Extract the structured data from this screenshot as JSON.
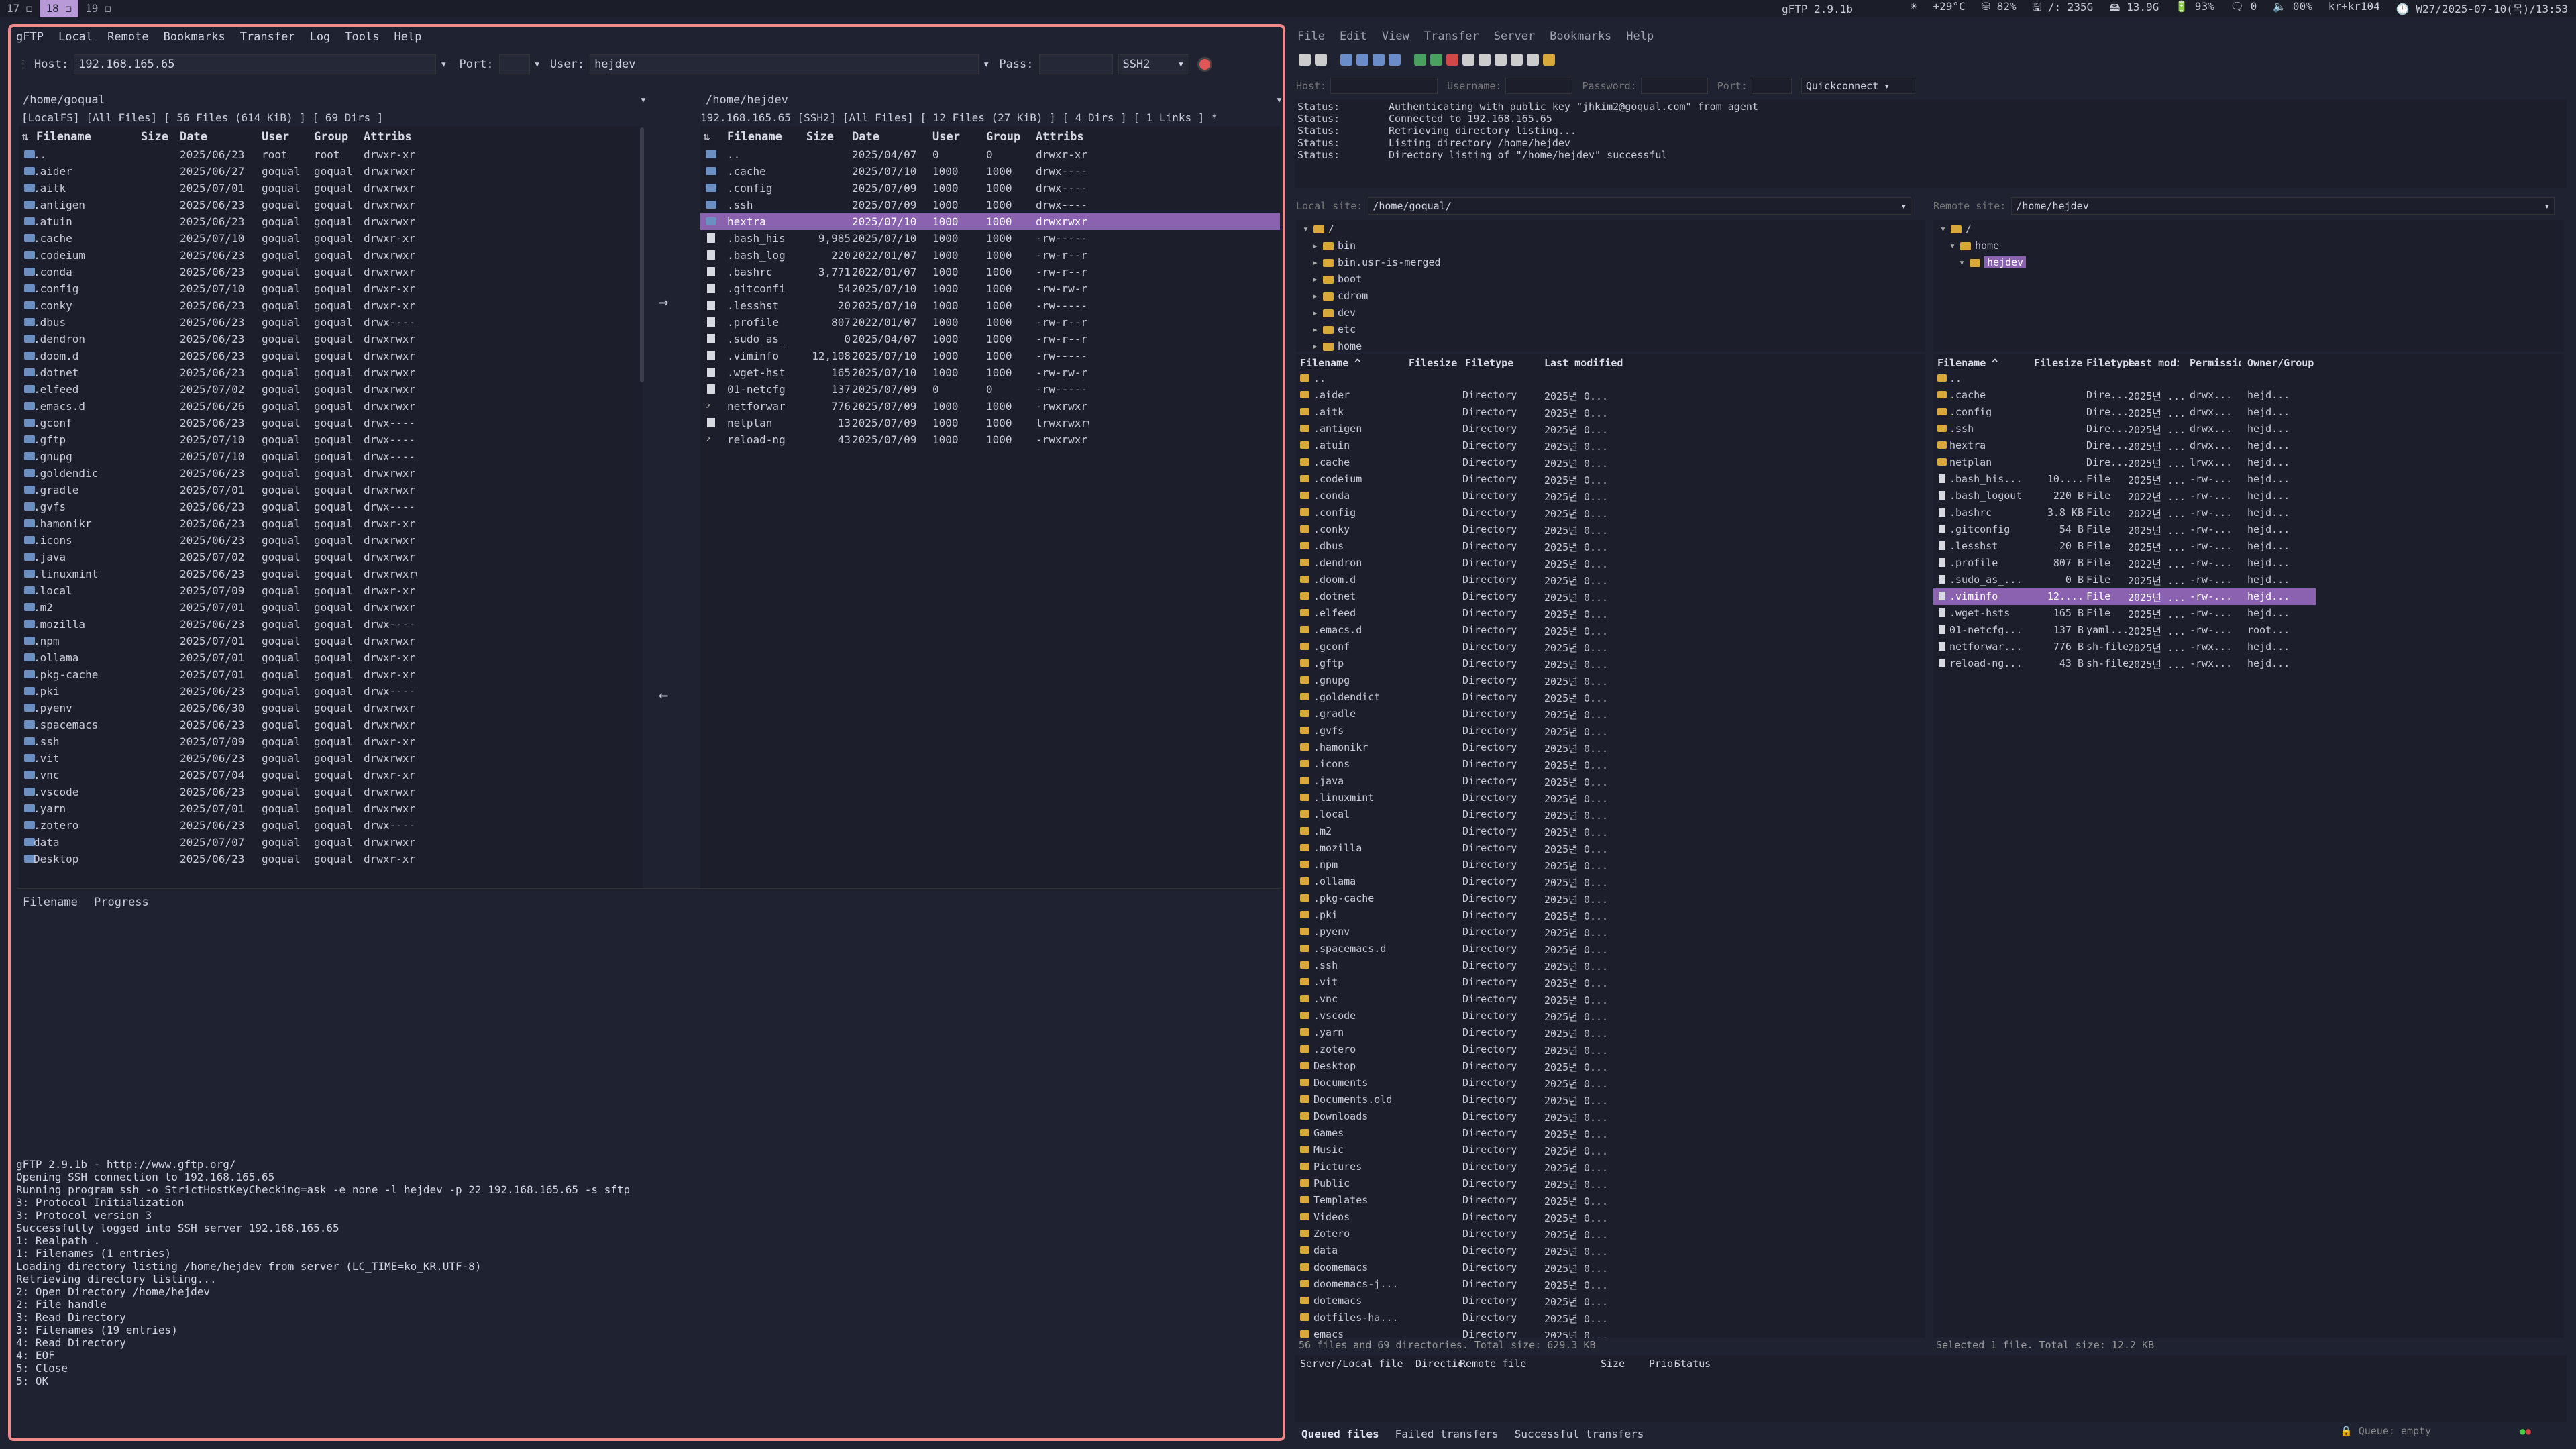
{
  "topbar": {
    "workspaces": [
      {
        "label": "17 ◻",
        "active": false
      },
      {
        "label": "18 ◻",
        "active": true
      },
      {
        "label": "19 ◻",
        "active": false
      }
    ],
    "title": "gFTP 2.9.1b",
    "status": [
      "☀",
      "+29°C",
      "⛁ 82%",
      "🖫 /: 235G",
      "🖴 13.9G",
      "🔋 93%",
      "🗨 0",
      "🔈 00%",
      "kr+kr104",
      "🕒 W27/2025-07-10(목)/13:53"
    ]
  },
  "left": {
    "menu": [
      "gFTP",
      "Local",
      "Remote",
      "Bookmarks",
      "Transfer",
      "Log",
      "Tools",
      "Help"
    ],
    "host_label": "Host:",
    "host": "192.168.165.65",
    "port_label": "Port:",
    "port": "",
    "user_label": "User:",
    "user": "hejdev",
    "pass_label": "Pass:",
    "pass": "",
    "protocol": "SSH2",
    "local_path": "/home/goqual",
    "remote_path": "/home/hejdev",
    "local_status": "[LocalFS] [All Files] [ 56 Files (614 KiB) ] [ 69 Dirs ]",
    "remote_status": "192.168.165.65 [SSH2] [All Files] [ 12 Files (27 KiB) ] [ 4 Dirs ] [ 1 Links ] *",
    "cols": [
      "Filename",
      "Size",
      "Date",
      "User",
      "Group",
      "Attribs"
    ],
    "local_files": [
      [
        "..",
        "",
        "2025/06/23",
        "root",
        "root",
        "drwxr-xr-x"
      ],
      [
        ".aider",
        "",
        "2025/06/27",
        "goqual",
        "goqual",
        "drwxrwxr-x"
      ],
      [
        ".aitk",
        "",
        "2025/07/01",
        "goqual",
        "goqual",
        "drwxrwxr-x"
      ],
      [
        ".antigen",
        "",
        "2025/06/23",
        "goqual",
        "goqual",
        "drwxrwxr-x"
      ],
      [
        ".atuin",
        "",
        "2025/06/23",
        "goqual",
        "goqual",
        "drwxrwxr-x"
      ],
      [
        ".cache",
        "",
        "2025/07/10",
        "goqual",
        "goqual",
        "drwxr-xr-x"
      ],
      [
        ".codeium",
        "",
        "2025/06/23",
        "goqual",
        "goqual",
        "drwxrwxr-x"
      ],
      [
        ".conda",
        "",
        "2025/06/23",
        "goqual",
        "goqual",
        "drwxrwxr-x"
      ],
      [
        ".config",
        "",
        "2025/07/10",
        "goqual",
        "goqual",
        "drwxr-xr-x"
      ],
      [
        ".conky",
        "",
        "2025/06/23",
        "goqual",
        "goqual",
        "drwxr-xr-x"
      ],
      [
        ".dbus",
        "",
        "2025/06/23",
        "goqual",
        "goqual",
        "drwx------"
      ],
      [
        ".dendron",
        "",
        "2025/06/23",
        "goqual",
        "goqual",
        "drwxrwxr-x"
      ],
      [
        ".doom.d",
        "",
        "2025/06/23",
        "goqual",
        "goqual",
        "drwxrwxr-x"
      ],
      [
        ".dotnet",
        "",
        "2025/06/23",
        "goqual",
        "goqual",
        "drwxrwxr-x"
      ],
      [
        ".elfeed",
        "",
        "2025/07/02",
        "goqual",
        "goqual",
        "drwxrwxr-x"
      ],
      [
        ".emacs.d",
        "",
        "2025/06/26",
        "goqual",
        "goqual",
        "drwxrwxr-x"
      ],
      [
        ".gconf",
        "",
        "2025/06/23",
        "goqual",
        "goqual",
        "drwx------"
      ],
      [
        ".gftp",
        "",
        "2025/07/10",
        "goqual",
        "goqual",
        "drwx------"
      ],
      [
        ".gnupg",
        "",
        "2025/07/10",
        "goqual",
        "goqual",
        "drwx------"
      ],
      [
        ".goldendict",
        "",
        "2025/06/23",
        "goqual",
        "goqual",
        "drwxrwxr-x"
      ],
      [
        ".gradle",
        "",
        "2025/07/01",
        "goqual",
        "goqual",
        "drwxrwxr-x"
      ],
      [
        ".gvfs",
        "",
        "2025/06/23",
        "goqual",
        "goqual",
        "drwx------"
      ],
      [
        ".hamonikr",
        "",
        "2025/06/23",
        "goqual",
        "goqual",
        "drwxr-xr-x"
      ],
      [
        ".icons",
        "",
        "2025/06/23",
        "goqual",
        "goqual",
        "drwxrwxr-x"
      ],
      [
        ".java",
        "",
        "2025/07/02",
        "goqual",
        "goqual",
        "drwxrwxr-x"
      ],
      [
        ".linuxmint",
        "",
        "2025/06/23",
        "goqual",
        "goqual",
        "drwxrwxrwx"
      ],
      [
        ".local",
        "",
        "2025/07/09",
        "goqual",
        "goqual",
        "drwxr-xr-x"
      ],
      [
        ".m2",
        "",
        "2025/07/01",
        "goqual",
        "goqual",
        "drwxrwxr-x"
      ],
      [
        ".mozilla",
        "",
        "2025/06/23",
        "goqual",
        "goqual",
        "drwx------"
      ],
      [
        ".npm",
        "",
        "2025/07/01",
        "goqual",
        "goqual",
        "drwxrwxr-x"
      ],
      [
        ".ollama",
        "",
        "2025/07/01",
        "goqual",
        "goqual",
        "drwxr-xr-x"
      ],
      [
        ".pkg-cache",
        "",
        "2025/07/01",
        "goqual",
        "goqual",
        "drwxr-xr-x"
      ],
      [
        ".pki",
        "",
        "2025/06/23",
        "goqual",
        "goqual",
        "drwx------"
      ],
      [
        ".pyenv",
        "",
        "2025/06/30",
        "goqual",
        "goqual",
        "drwxrwxr-x"
      ],
      [
        ".spacemacs",
        "",
        "2025/06/23",
        "goqual",
        "goqual",
        "drwxrwxr-x"
      ],
      [
        ".ssh",
        "",
        "2025/07/09",
        "goqual",
        "goqual",
        "drwxr-xr-x"
      ],
      [
        ".vit",
        "",
        "2025/06/23",
        "goqual",
        "goqual",
        "drwxrwxr-x"
      ],
      [
        ".vnc",
        "",
        "2025/07/04",
        "goqual",
        "goqual",
        "drwxr-xr-x"
      ],
      [
        ".vscode",
        "",
        "2025/06/23",
        "goqual",
        "goqual",
        "drwxrwxr-x"
      ],
      [
        ".yarn",
        "",
        "2025/07/01",
        "goqual",
        "goqual",
        "drwxrwxr-x"
      ],
      [
        ".zotero",
        "",
        "2025/06/23",
        "goqual",
        "goqual",
        "drwx------"
      ],
      [
        "data",
        "",
        "2025/07/07",
        "goqual",
        "goqual",
        "drwxrwxr-x"
      ],
      [
        "Desktop",
        "",
        "2025/06/23",
        "goqual",
        "goqual",
        "drwxr-xr-x"
      ]
    ],
    "remote_files": [
      [
        "..",
        "",
        "2025/04/07",
        "0",
        "0",
        "drwxr-xr-x",
        "d"
      ],
      [
        ".cache",
        "",
        "2025/07/10",
        "1000",
        "1000",
        "drwx------",
        "d"
      ],
      [
        ".config",
        "",
        "2025/07/09",
        "1000",
        "1000",
        "drwx------",
        "d"
      ],
      [
        ".ssh",
        "",
        "2025/07/09",
        "1000",
        "1000",
        "drwx------",
        "d"
      ],
      [
        "hextra",
        "",
        "2025/07/10",
        "1000",
        "1000",
        "drwxrwxr-x",
        "d"
      ],
      [
        ".bash_his",
        "9,985",
        "2025/07/10",
        "1000",
        "1000",
        "-rw-------",
        "f"
      ],
      [
        ".bash_log",
        "220",
        "2022/01/07",
        "1000",
        "1000",
        "-rw-r--r--",
        "f"
      ],
      [
        ".bashrc",
        "3,771",
        "2022/01/07",
        "1000",
        "1000",
        "-rw-r--r--",
        "f"
      ],
      [
        ".gitconfi",
        "54",
        "2025/07/10",
        "1000",
        "1000",
        "-rw-rw-r--",
        "f"
      ],
      [
        ".lesshst",
        "20",
        "2025/07/10",
        "1000",
        "1000",
        "-rw-------",
        "f"
      ],
      [
        ".profile",
        "807",
        "2022/01/07",
        "1000",
        "1000",
        "-rw-r--r--",
        "f"
      ],
      [
        ".sudo_as_",
        "0",
        "2025/04/07",
        "1000",
        "1000",
        "-rw-r--r--",
        "f"
      ],
      [
        ".viminfo",
        "12,108",
        "2025/07/10",
        "1000",
        "1000",
        "-rw-------",
        "f"
      ],
      [
        ".wget-hst",
        "165",
        "2025/07/10",
        "1000",
        "1000",
        "-rw-rw-r--",
        "f"
      ],
      [
        "01-netcfg",
        "137",
        "2025/07/09",
        "0",
        "0",
        "-rw-------",
        "f"
      ],
      [
        "netforwar",
        "776",
        "2025/07/09",
        "1000",
        "1000",
        "-rwxrwxr-x",
        "l"
      ],
      [
        "netplan",
        "13",
        "2025/07/09",
        "1000",
        "1000",
        "lrwxrwxrwx",
        "f"
      ],
      [
        "reload-ng",
        "43",
        "2025/07/09",
        "1000",
        "1000",
        "-rwxrwxr-x",
        "l"
      ]
    ],
    "selected_remote": "hextra",
    "transfer_cols": [
      "Filename",
      "Progress"
    ],
    "log": [
      "gFTP 2.9.1b - http://www.gftp.org/",
      "Opening SSH connection to 192.168.165.65",
      "Running program ssh -o StrictHostKeyChecking=ask -e none -l hejdev -p 22 192.168.165.65 -s sftp",
      "3: Protocol Initialization",
      "3: Protocol version 3",
      "Successfully logged into SSH server 192.168.165.65",
      "1: Realpath .",
      "1: Filenames (1 entries)",
      "Loading directory listing /home/hejdev from server (LC_TIME=ko_KR.UTF-8)",
      "Retrieving directory listing...",
      "2: Open Directory /home/hejdev",
      "2: File handle",
      "3: Read Directory",
      "3: Filenames (19 entries)",
      "4: Read Directory",
      "4: EOF",
      "5: Close",
      "5: OK"
    ]
  },
  "right": {
    "menu": [
      "File",
      "Edit",
      "View",
      "Transfer",
      "Server",
      "Bookmarks",
      "Help"
    ],
    "qc": {
      "host": "Host:",
      "username": "Username:",
      "password": "Password:",
      "port": "Port:",
      "button": "Quickconnect"
    },
    "status": [
      [
        "Status:",
        "Authenticating with public key \"jhkim2@goqual.com\" from agent"
      ],
      [
        "Status:",
        "Connected to 192.168.165.65"
      ],
      [
        "Status:",
        "Retrieving directory listing..."
      ],
      [
        "Status:",
        "Listing directory /home/hejdev"
      ],
      [
        "Status:",
        "Directory listing of \"/home/hejdev\" successful"
      ]
    ],
    "local_site_label": "Local site:",
    "local_site": "/home/goqual/",
    "remote_site_label": "Remote site:",
    "remote_site": "/home/hejdev",
    "local_tree": [
      {
        "label": "/",
        "indent": 0,
        "open": true
      },
      {
        "label": "bin",
        "indent": 1,
        "open": false
      },
      {
        "label": "bin.usr-is-merged",
        "indent": 1,
        "open": false
      },
      {
        "label": "boot",
        "indent": 1,
        "open": false
      },
      {
        "label": "cdrom",
        "indent": 1,
        "open": false
      },
      {
        "label": "dev",
        "indent": 1,
        "open": false
      },
      {
        "label": "etc",
        "indent": 1,
        "open": false
      },
      {
        "label": "home",
        "indent": 1,
        "open": false
      }
    ],
    "remote_tree": [
      {
        "label": "/",
        "indent": 0,
        "sel": false
      },
      {
        "label": "home",
        "indent": 1,
        "sel": false
      },
      {
        "label": "hejdev",
        "indent": 2,
        "sel": true
      }
    ],
    "local_cols": [
      "Filename ^",
      "Filesize",
      "Filetype",
      "Last modified"
    ],
    "local_type": "Directory",
    "local_mod": "2025년 0...",
    "local_list": [
      "..",
      ".aider",
      ".aitk",
      ".antigen",
      ".atuin",
      ".cache",
      ".codeium",
      ".conda",
      ".config",
      ".conky",
      ".dbus",
      ".dendron",
      ".doom.d",
      ".dotnet",
      ".elfeed",
      ".emacs.d",
      ".gconf",
      ".gftp",
      ".gnupg",
      ".goldendict",
      ".gradle",
      ".gvfs",
      ".hamonikr",
      ".icons",
      ".java",
      ".linuxmint",
      ".local",
      ".m2",
      ".mozilla",
      ".npm",
      ".ollama",
      ".pkg-cache",
      ".pki",
      ".pyenv",
      ".spacemacs.d",
      ".ssh",
      ".vit",
      ".vnc",
      ".vscode",
      ".yarn",
      ".zotero",
      "Desktop",
      "Documents",
      "Documents.old",
      "Downloads",
      "Games",
      "Music",
      "Pictures",
      "Public",
      "Templates",
      "Videos",
      "Zotero",
      "data",
      "doomemacs",
      "doomemacs-j...",
      "dotemacs",
      "dotfiles-ha...",
      "emacs"
    ],
    "remote_cols": [
      "Filename ^",
      "Filesize",
      "Filetype",
      "Last modified",
      "Permissions",
      "Owner/Group"
    ],
    "remote_list": [
      [
        "..",
        "",
        "",
        "",
        "",
        ""
      ],
      [
        ".cache",
        "",
        "Dire...",
        "2025년 ...",
        "drwx...",
        "hejd..."
      ],
      [
        ".config",
        "",
        "Dire...",
        "2025년 ...",
        "drwx...",
        "hejd..."
      ],
      [
        ".ssh",
        "",
        "Dire...",
        "2025년 ...",
        "drwx...",
        "hejd..."
      ],
      [
        "hextra",
        "",
        "Dire...",
        "2025년 ...",
        "drwx...",
        "hejd..."
      ],
      [
        "netplan",
        "",
        "Dire...",
        "2025년 ...",
        "lrwx...",
        "hejd..."
      ],
      [
        ".bash_his...",
        "10....",
        "File",
        "2025년 ...",
        "-rw-...",
        "hejd..."
      ],
      [
        ".bash_logout",
        "220 B",
        "File",
        "2022년 ...",
        "-rw-...",
        "hejd..."
      ],
      [
        ".bashrc",
        "3.8 KB",
        "File",
        "2022년 ...",
        "-rw-...",
        "hejd..."
      ],
      [
        ".gitconfig",
        "54 B",
        "File",
        "2025년 ...",
        "-rw-...",
        "hejd..."
      ],
      [
        ".lesshst",
        "20 B",
        "File",
        "2025년 ...",
        "-rw-...",
        "hejd..."
      ],
      [
        ".profile",
        "807 B",
        "File",
        "2022년 ...",
        "-rw-...",
        "hejd..."
      ],
      [
        ".sudo_as_...",
        "0 B",
        "File",
        "2025년 ...",
        "-rw-...",
        "hejd..."
      ],
      [
        ".viminfo",
        "12....",
        "File",
        "2025년 ...",
        "-rw-...",
        "hejd..."
      ],
      [
        ".wget-hsts",
        "165 B",
        "File",
        "2025년 ...",
        "-rw-...",
        "hejd..."
      ],
      [
        "01-netcfg...",
        "137 B",
        "yaml...",
        "2025년 ...",
        "-rw-...",
        "root..."
      ],
      [
        "netforwar...",
        "776 B",
        "sh-file",
        "2025년 ...",
        "-rwx...",
        "hejd..."
      ],
      [
        "reload-ng...",
        "43 B",
        "sh-file",
        "2025년 ...",
        "-rwx...",
        "hejd..."
      ]
    ],
    "selected_remote": ".viminfo",
    "local_summary": "56 files and 69 directories. Total size: 629.3 KB",
    "remote_summary": "Selected 1 file. Total size: 12.2 KB",
    "queue_cols": [
      "Server/Local file",
      "Direction",
      "Remote file",
      "Size",
      "Priority",
      "Status"
    ],
    "tabs": [
      "Queued files",
      "Failed transfers",
      "Successful transfers"
    ],
    "queue_status": "Queue: empty"
  }
}
